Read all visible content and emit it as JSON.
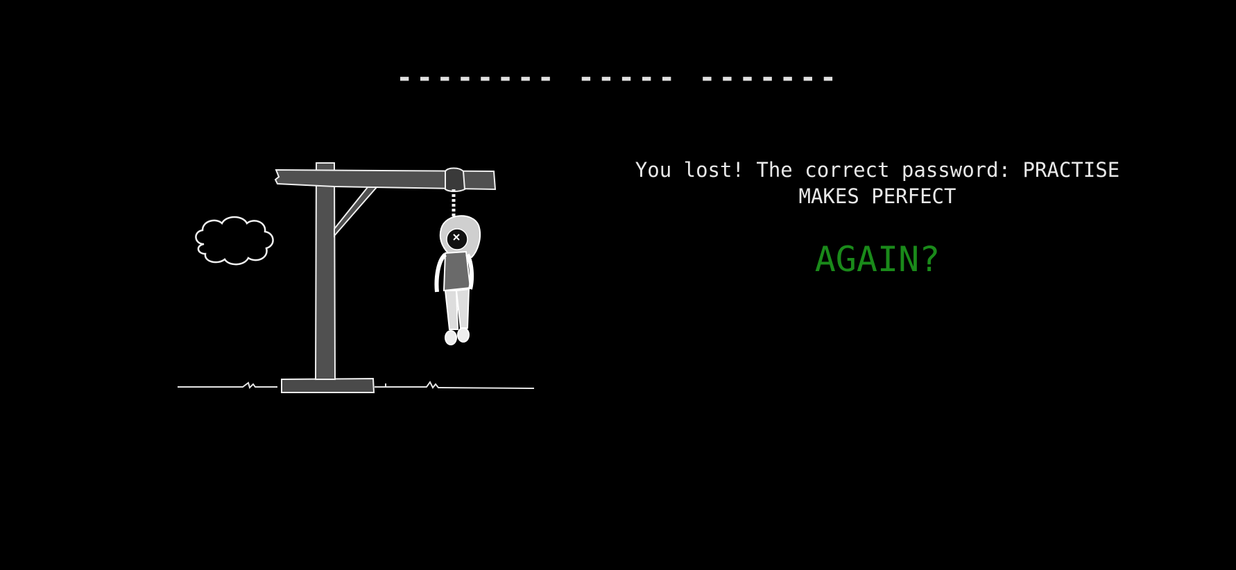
{
  "game": {
    "word_mask": "-------- ----- -------",
    "result_message": "You lost! The correct password: PRACTISE MAKES PERFECT",
    "again_label": "AGAIN?"
  },
  "colors": {
    "background": "#000000",
    "text": "#e8e8e8",
    "again": "#1a8a1a"
  },
  "icons": {
    "scene": "gallows-hanged-man-drawing",
    "cloud": "cloud-icon"
  }
}
